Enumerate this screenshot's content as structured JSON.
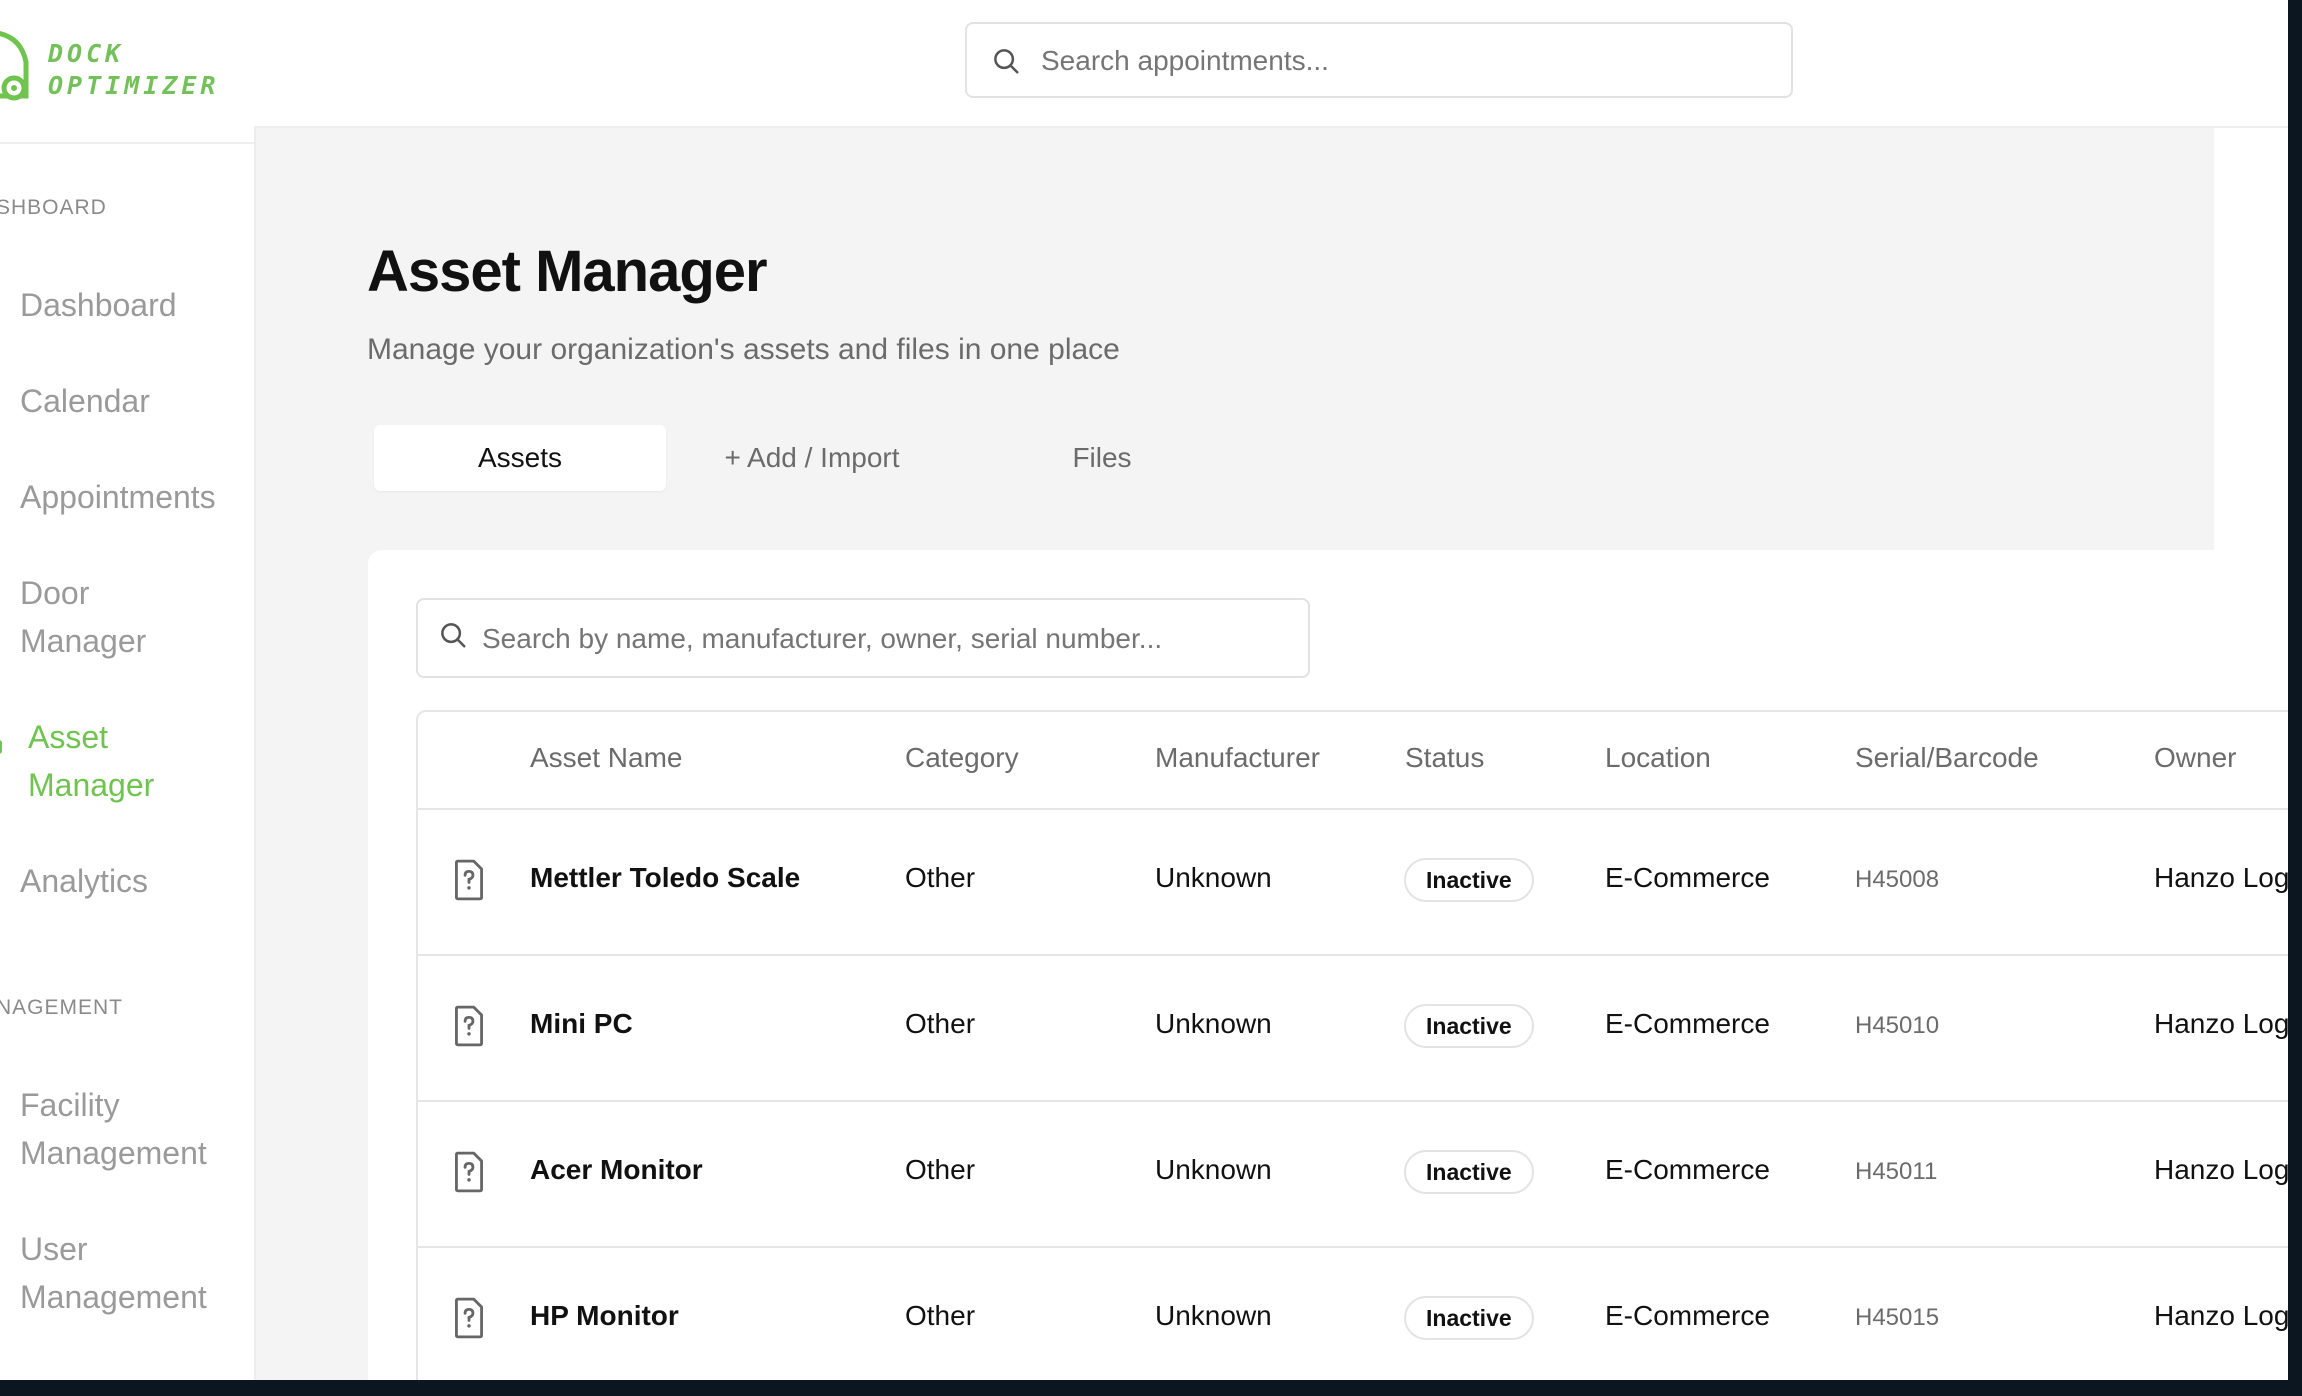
{
  "brand": {
    "line1": "DOCK",
    "line2": "OPTIMIZER",
    "accent": "#6ec44f"
  },
  "sidebar": {
    "section_dashboard": "SHBOARD",
    "section_management": "NAGEMENT",
    "items": [
      {
        "label": "Dashboard"
      },
      {
        "label": "Calendar"
      },
      {
        "label": "Appointments"
      },
      {
        "label": "Door Manager"
      },
      {
        "label": "Asset Manager",
        "active": true
      },
      {
        "label": "Analytics"
      },
      {
        "label": "Facility Management"
      },
      {
        "label": "User Management"
      }
    ]
  },
  "topbar": {
    "search_placeholder": "Search appointments..."
  },
  "page": {
    "title": "Asset Manager",
    "subtitle": "Manage your organization's assets and files in one place"
  },
  "tabs": [
    {
      "label": "Assets",
      "active": true
    },
    {
      "label": "+ Add / Import"
    },
    {
      "label": "Files"
    }
  ],
  "assets_search": {
    "placeholder": "Search by name, manufacturer, owner, serial number..."
  },
  "table": {
    "columns": [
      "Asset Name",
      "Category",
      "Manufacturer",
      "Status",
      "Location",
      "Serial/Barcode",
      "Owner"
    ],
    "rows": [
      {
        "name": "Mettler Toledo Scale",
        "category": "Other",
        "manufacturer": "Unknown",
        "status": "Inactive",
        "location": "E-Commerce",
        "serial": "H45008",
        "owner": "Hanzo Logistics"
      },
      {
        "name": "Mini PC",
        "category": "Other",
        "manufacturer": "Unknown",
        "status": "Inactive",
        "location": "E-Commerce",
        "serial": "H45010",
        "owner": "Hanzo Logistics"
      },
      {
        "name": "Acer Monitor",
        "category": "Other",
        "manufacturer": "Unknown",
        "status": "Inactive",
        "location": "E-Commerce",
        "serial": "H45011",
        "owner": "Hanzo Logistics"
      },
      {
        "name": "HP Monitor",
        "category": "Other",
        "manufacturer": "Unknown",
        "status": "Inactive",
        "location": "E-Commerce",
        "serial": "H45015",
        "owner": "Hanzo Logistics"
      }
    ]
  }
}
